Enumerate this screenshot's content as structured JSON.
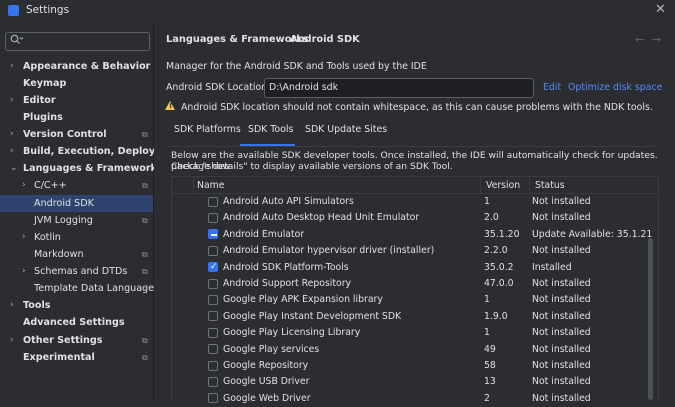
{
  "window": {
    "title": "Settings",
    "close_glyph": "✕"
  },
  "search": {
    "placeholder": "",
    "icon": "search-icon"
  },
  "sidebar": {
    "items": [
      {
        "label": "Appearance & Behavior",
        "bold": true,
        "arrow": "›",
        "indent": 0
      },
      {
        "label": "Keymap",
        "bold": true,
        "arrow": "",
        "indent": 0
      },
      {
        "label": "Editor",
        "bold": true,
        "arrow": "›",
        "indent": 0
      },
      {
        "label": "Plugins",
        "bold": true,
        "arrow": "",
        "indent": 0
      },
      {
        "label": "Version Control",
        "bold": true,
        "arrow": "›",
        "indent": 0,
        "copy": true
      },
      {
        "label": "Build, Execution, Deployment",
        "bold": true,
        "arrow": "›",
        "indent": 0
      },
      {
        "label": "Languages & Frameworks",
        "bold": true,
        "arrow": "⌄",
        "indent": 0
      },
      {
        "label": "C/C++",
        "bold": false,
        "arrow": "›",
        "indent": 1,
        "copy": true
      },
      {
        "label": "Android SDK",
        "bold": false,
        "arrow": "",
        "indent": 1,
        "selected": true
      },
      {
        "label": "JVM Logging",
        "bold": false,
        "arrow": "",
        "indent": 1,
        "copy": true
      },
      {
        "label": "Kotlin",
        "bold": false,
        "arrow": "›",
        "indent": 1
      },
      {
        "label": "Markdown",
        "bold": false,
        "arrow": "",
        "indent": 1,
        "copy": true
      },
      {
        "label": "Schemas and DTDs",
        "bold": false,
        "arrow": "›",
        "indent": 1,
        "copy": true
      },
      {
        "label": "Template Data Languages",
        "bold": false,
        "arrow": "",
        "indent": 1,
        "copy": true
      },
      {
        "label": "Tools",
        "bold": true,
        "arrow": "›",
        "indent": 0
      },
      {
        "label": "Advanced Settings",
        "bold": true,
        "arrow": "",
        "indent": 0
      },
      {
        "label": "Other Settings",
        "bold": true,
        "arrow": "›",
        "indent": 0,
        "copy": true
      },
      {
        "label": "Experimental",
        "bold": true,
        "arrow": "",
        "indent": 0,
        "copy": true
      }
    ],
    "copy_glyph": "⧉"
  },
  "header": {
    "breadcrumb_parent": "Languages & Frameworks",
    "breadcrumb_sep": "›",
    "breadcrumb_current": "Android SDK",
    "back_glyph": "←",
    "forward_glyph": "→"
  },
  "sdk": {
    "description": "Manager for the Android SDK and Tools used by the IDE",
    "location_label": "Android SDK Location:",
    "location_value": "D:\\Android sdk",
    "edit_label": "Edit",
    "optimize_label": "Optimize disk space",
    "warning_bang": "!",
    "warning": "Android SDK location should not contain whitespace, as this can cause problems with the NDK tools."
  },
  "tabs": [
    {
      "label": "SDK Platforms"
    },
    {
      "label": "SDK Tools",
      "active": true
    },
    {
      "label": "SDK Update Sites"
    }
  ],
  "info": {
    "line1": "Below are the available SDK developer tools. Once installed, the IDE will automatically check for updates. Check \"show",
    "line2": "package details\" to display available versions of an SDK Tool."
  },
  "table": {
    "columns": {
      "name": "Name",
      "version": "Version",
      "status": "Status"
    },
    "rows": [
      {
        "name": "Android Auto API Simulators",
        "version": "1",
        "status": "Not installed",
        "state": "unchecked"
      },
      {
        "name": "Android Auto Desktop Head Unit Emulator",
        "version": "2.0",
        "status": "Not installed",
        "state": "unchecked"
      },
      {
        "name": "Android Emulator",
        "version": "35.1.20",
        "status": "Update Available: 35.1.21",
        "state": "partial"
      },
      {
        "name": "Android Emulator hypervisor driver (installer)",
        "version": "2.2.0",
        "status": "Not installed",
        "state": "unchecked"
      },
      {
        "name": "Android SDK Platform-Tools",
        "version": "35.0.2",
        "status": "Installed",
        "state": "checked"
      },
      {
        "name": "Android Support Repository",
        "version": "47.0.0",
        "status": "Not installed",
        "state": "unchecked"
      },
      {
        "name": "Google Play APK Expansion library",
        "version": "1",
        "status": "Not installed",
        "state": "unchecked"
      },
      {
        "name": "Google Play Instant Development SDK",
        "version": "1.9.0",
        "status": "Not installed",
        "state": "unchecked"
      },
      {
        "name": "Google Play Licensing Library",
        "version": "1",
        "status": "Not installed",
        "state": "unchecked"
      },
      {
        "name": "Google Play services",
        "version": "49",
        "status": "Not installed",
        "state": "unchecked"
      },
      {
        "name": "Google Repository",
        "version": "58",
        "status": "Not installed",
        "state": "unchecked"
      },
      {
        "name": "Google USB Driver",
        "version": "13",
        "status": "Not installed",
        "state": "unchecked"
      },
      {
        "name": "Google Web Driver",
        "version": "2",
        "status": "Not installed",
        "state": "unchecked"
      }
    ],
    "check_glyph": "✓"
  },
  "colors": {
    "accent": "#3574f0",
    "link": "#548af7",
    "warning": "#f2c55c",
    "selection": "#2e436e"
  }
}
